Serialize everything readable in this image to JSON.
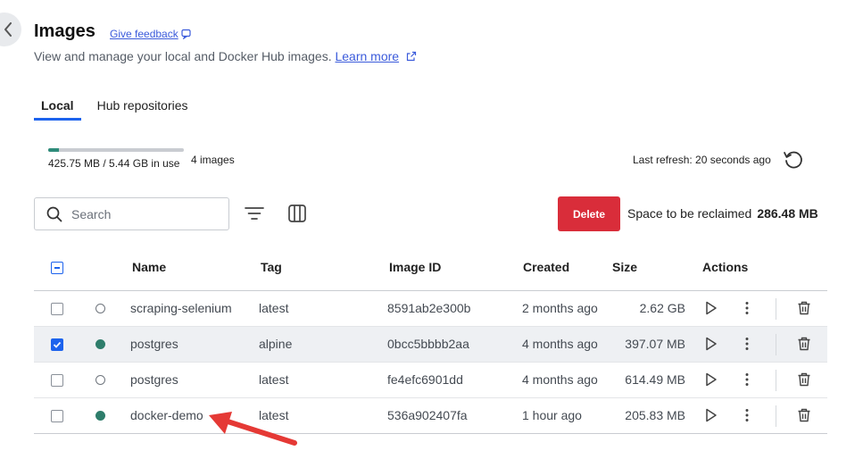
{
  "header": {
    "title": "Images",
    "feedback_label": "Give feedback",
    "subtitle": "View and manage your local and Docker Hub images.",
    "learn_more": "Learn more"
  },
  "tabs": [
    {
      "label": "Local",
      "active": true
    },
    {
      "label": "Hub repositories",
      "active": false
    }
  ],
  "usage": {
    "text": "425.75 MB / 5.44 GB in use",
    "fraction": 0.08,
    "count": "4 images"
  },
  "refresh": {
    "text": "Last refresh: 20 seconds ago"
  },
  "toolbar": {
    "search_placeholder": "Search",
    "delete_label": "Delete",
    "reclaim_label": "Space to be reclaimed",
    "reclaim_value": "286.48 MB"
  },
  "table": {
    "columns": {
      "name": "Name",
      "tag": "Tag",
      "image_id": "Image ID",
      "created": "Created",
      "size": "Size",
      "actions": "Actions"
    },
    "rows": [
      {
        "name": "scraping-selenium",
        "tag": "latest",
        "image_id": "8591ab2e300b",
        "created": "2 months ago",
        "size": "2.62 GB",
        "in_use": false,
        "selected": false
      },
      {
        "name": "postgres",
        "tag": "alpine",
        "image_id": "0bcc5bbbb2aa",
        "created": "4 months ago",
        "size": "397.07 MB",
        "in_use": true,
        "selected": true
      },
      {
        "name": "postgres",
        "tag": "latest",
        "image_id": "fe4efc6901dd",
        "created": "4 months ago",
        "size": "614.49 MB",
        "in_use": false,
        "selected": false
      },
      {
        "name": "docker-demo",
        "tag": "latest",
        "image_id": "536a902407fa",
        "created": "1 hour ago",
        "size": "205.83 MB",
        "in_use": true,
        "selected": false
      }
    ]
  },
  "colors": {
    "accent": "#1d63ed",
    "delete": "#d92d3a",
    "in_use": "#2e7d6b",
    "annotation_arrow": "#e53935"
  },
  "icons": [
    "chevron-left-icon",
    "feedback-icon",
    "external-link-icon",
    "refresh-icon",
    "search-icon",
    "filter-icon",
    "columns-icon",
    "play-icon",
    "more-vertical-icon",
    "trash-icon"
  ]
}
